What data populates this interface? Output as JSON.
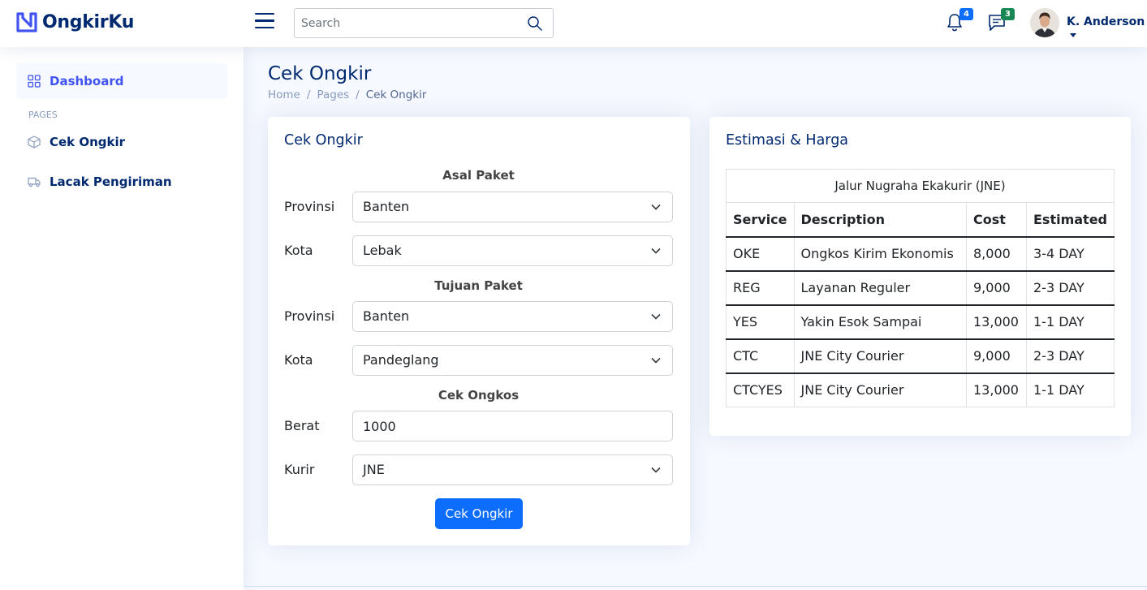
{
  "app": {
    "name": "OngkirKu"
  },
  "header": {
    "search_placeholder": "Search",
    "notifications_count": "4",
    "messages_count": "3",
    "profile_name": "K. Anderson"
  },
  "sidebar": {
    "dashboard": "Dashboard",
    "heading": "PAGES",
    "items": [
      {
        "label": "Cek Ongkir",
        "icon": "box-icon"
      },
      {
        "label": "Lacak Pengiriman",
        "icon": "truck-icon"
      }
    ]
  },
  "page": {
    "title": "Cek Ongkir",
    "breadcrumb": [
      "Home",
      "Pages",
      "Cek Ongkir"
    ]
  },
  "form_card": {
    "title": "Cek Ongkir",
    "origin_heading": "Asal Paket",
    "destination_heading": "Tujuan Paket",
    "cost_heading": "Cek Ongkos",
    "origin_province_label": "Provinsi",
    "origin_province": "Banten",
    "origin_city_label": "Kota",
    "origin_city": "Lebak",
    "dest_province_label": "Provinsi",
    "dest_province": "Banten",
    "dest_city_label": "Kota",
    "dest_city": "Pandeglang",
    "weight_label": "Berat",
    "weight": "1000",
    "courier_label": "Kurir",
    "courier": "JNE",
    "submit_label": "Cek Ongkir"
  },
  "result_card": {
    "title": "Estimasi & Harga",
    "courier_name": "Jalur Nugraha Ekakurir (JNE)",
    "columns": [
      "Service",
      "Description",
      "Cost",
      "Estimated"
    ],
    "rows": [
      [
        "OKE",
        "Ongkos Kirim Ekonomis",
        "8,000",
        "3-4 DAY"
      ],
      [
        "REG",
        "Layanan Reguler",
        "9,000",
        "2-3 DAY"
      ],
      [
        "YES",
        "Yakin Esok Sampai",
        "13,000",
        "1-1 DAY"
      ],
      [
        "CTC",
        "JNE City Courier",
        "9,000",
        "2-3 DAY"
      ],
      [
        "CTCYES",
        "JNE City Courier",
        "13,000",
        "1-1 DAY"
      ]
    ]
  },
  "colors": {
    "brand": "#4154f1",
    "navy": "#012970",
    "primary_button": "#0d6efd",
    "notif_badge": "#0d6efd",
    "message_badge": "#198754"
  }
}
